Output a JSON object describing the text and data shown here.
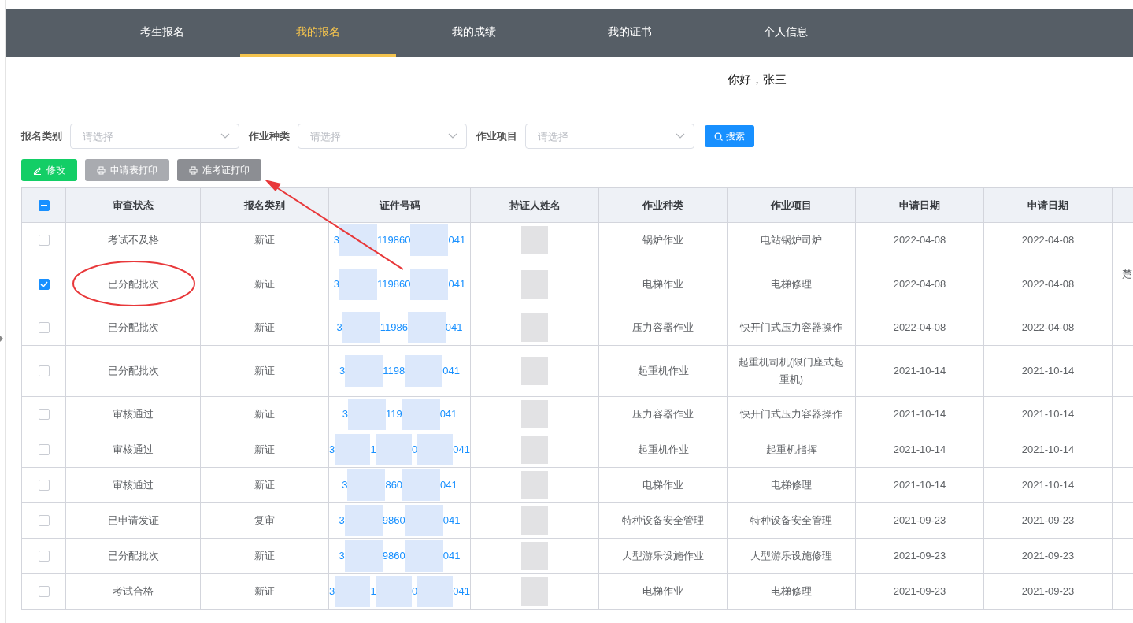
{
  "nav": {
    "tabs": [
      {
        "label": "考生报名",
        "selected": false
      },
      {
        "label": "我的报名",
        "selected": true
      },
      {
        "label": "我的成绩",
        "selected": false
      },
      {
        "label": "我的证书",
        "selected": false
      },
      {
        "label": "个人信息",
        "selected": false
      }
    ]
  },
  "greeting": "你好，张三",
  "filters": [
    {
      "label": "报名类别",
      "placeholder": "请选择"
    },
    {
      "label": "作业种类",
      "placeholder": "请选择"
    },
    {
      "label": "作业项目",
      "placeholder": "请选择"
    }
  ],
  "search_button": "搜索",
  "actions": [
    {
      "label": "修改",
      "kind": "edit",
      "disabled": false
    },
    {
      "label": "申请表打印",
      "kind": "print",
      "disabled": true
    },
    {
      "label": "准考证打印",
      "kind": "print",
      "disabled": false
    }
  ],
  "table": {
    "select_all": {
      "indeterminate": true
    },
    "columns": [
      "审查状态",
      "报名类别",
      "证件号码",
      "持证人姓名",
      "作业种类",
      "作业项目",
      "申请日期",
      "申请日期"
    ],
    "rows": [
      {
        "checked": false,
        "status": "考试不及格",
        "category": "新证",
        "id_parts": [
          "3",
          "119860",
          "041"
        ],
        "work_type": "锅炉作业",
        "work_item": "电站锅炉司炉",
        "date_1": "2022-04-08",
        "date_2": "2022-04-08"
      },
      {
        "checked": true,
        "status": "已分配批次",
        "category": "新证",
        "id_parts": [
          "3",
          "119860",
          "041"
        ],
        "work_type": "电梯作业",
        "work_item": "电梯修理",
        "date_1": "2022-04-08",
        "date_2": "2022-04-08",
        "column_9": "楚"
      },
      {
        "checked": false,
        "status": "已分配批次",
        "category": "新证",
        "id_parts": [
          "3",
          "11986",
          "041"
        ],
        "work_type": "压力容器作业",
        "work_item": "快开门式压力容器操作",
        "date_1": "2022-04-08",
        "date_2": "2022-04-08"
      },
      {
        "checked": false,
        "status": "已分配批次",
        "category": "新证",
        "id_parts": [
          "3",
          "1198",
          "041"
        ],
        "work_type": "起重机作业",
        "work_item": "起重机司机(限门座式起重机)",
        "date_1": "2021-10-14",
        "date_2": "2021-10-14"
      },
      {
        "checked": false,
        "status": "审核通过",
        "category": "新证",
        "id_parts": [
          "3",
          "119",
          "041"
        ],
        "work_type": "压力容器作业",
        "work_item": "快开门式压力容器操作",
        "date_1": "2021-10-14",
        "date_2": "2021-10-14"
      },
      {
        "checked": false,
        "status": "审核通过",
        "category": "新证",
        "id_parts": [
          "3",
          "1",
          "0",
          "041"
        ],
        "work_type": "起重机作业",
        "work_item": "起重机指挥",
        "date_1": "2021-10-14",
        "date_2": "2021-10-14"
      },
      {
        "checked": false,
        "status": "审核通过",
        "category": "新证",
        "id_parts": [
          "3",
          "860",
          "041"
        ],
        "work_type": "电梯作业",
        "work_item": "电梯修理",
        "date_1": "2021-10-14",
        "date_2": "2021-10-14"
      },
      {
        "checked": false,
        "status": "已申请发证",
        "category": "复审",
        "id_parts": [
          "3",
          "9860",
          "041"
        ],
        "work_type": "特种设备安全管理",
        "work_item": "特种设备安全管理",
        "date_1": "2021-09-23",
        "date_2": "2021-09-23"
      },
      {
        "checked": false,
        "status": "已分配批次",
        "category": "新证",
        "id_parts": [
          "3",
          "9860",
          "041"
        ],
        "work_type": "大型游乐设施作业",
        "work_item": "大型游乐设施修理",
        "date_1": "2021-09-23",
        "date_2": "2021-09-23"
      },
      {
        "checked": false,
        "status": "考试合格",
        "category": "新证",
        "id_parts": [
          "3",
          "1",
          "0",
          "041"
        ],
        "work_type": "电梯作业",
        "work_item": "电梯修理",
        "date_1": "2021-09-23",
        "date_2": "2021-09-23"
      }
    ]
  }
}
